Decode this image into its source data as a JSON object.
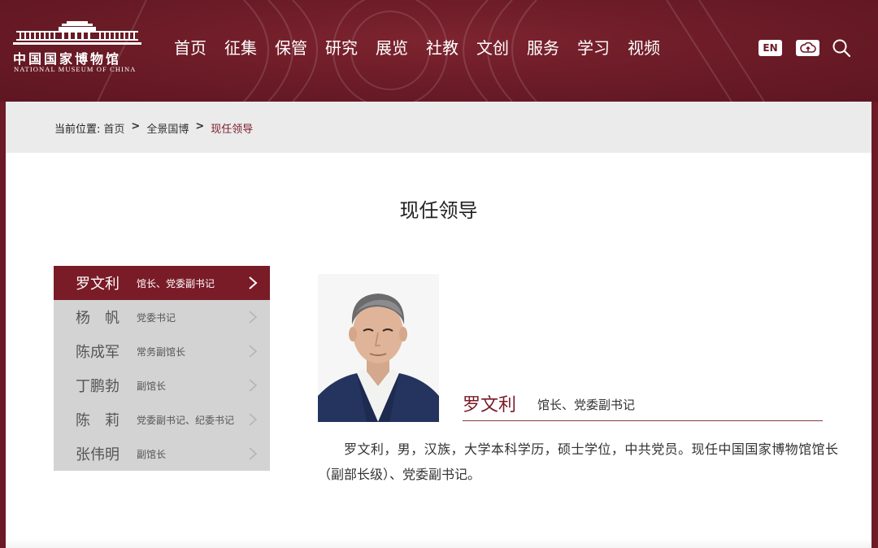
{
  "header": {
    "logo": {
      "name_cn": "中国国家博物馆",
      "name_en": "NATIONAL MUSEUM OF CHINA"
    },
    "nav": [
      {
        "label": "首页"
      },
      {
        "label": "征集"
      },
      {
        "label": "保管"
      },
      {
        "label": "研究"
      },
      {
        "label": "展览"
      },
      {
        "label": "社教"
      },
      {
        "label": "文创"
      },
      {
        "label": "服务"
      },
      {
        "label": "学习"
      },
      {
        "label": "视频"
      }
    ],
    "tools": {
      "en_label": "EN",
      "cloud_icon": "cloud-upload-icon",
      "search_icon": "search-icon"
    }
  },
  "breadcrumb": {
    "label": "当前位置:",
    "items": [
      "首页",
      "全景国博",
      "现任领导"
    ],
    "separator": ">"
  },
  "page_title": "现任领导",
  "leaders": [
    {
      "name": "罗文利",
      "role": "馆长、党委副书记",
      "active": true
    },
    {
      "name": "杨　帆",
      "role": "党委书记",
      "active": false
    },
    {
      "name": "陈成军",
      "role": "常务副馆长",
      "active": false
    },
    {
      "name": "丁鹏勃",
      "role": "副馆长",
      "active": false
    },
    {
      "name": "陈　莉",
      "role": "党委副书记、纪委书记",
      "active": false
    },
    {
      "name": "张伟明",
      "role": "副馆长",
      "active": false
    }
  ],
  "detail": {
    "name": "罗文利",
    "role": "馆长、党委副书记",
    "bio": "罗文利，男，汉族，大学本科学历，硕士学位，中共党员。现任中国国家博物馆馆长（副部长级）、党委副书记。"
  },
  "colors": {
    "brand": "#6b1a26",
    "accent": "#7a1b28",
    "list_bg": "#d3d3d3",
    "crumb_bg": "#ebebeb"
  }
}
